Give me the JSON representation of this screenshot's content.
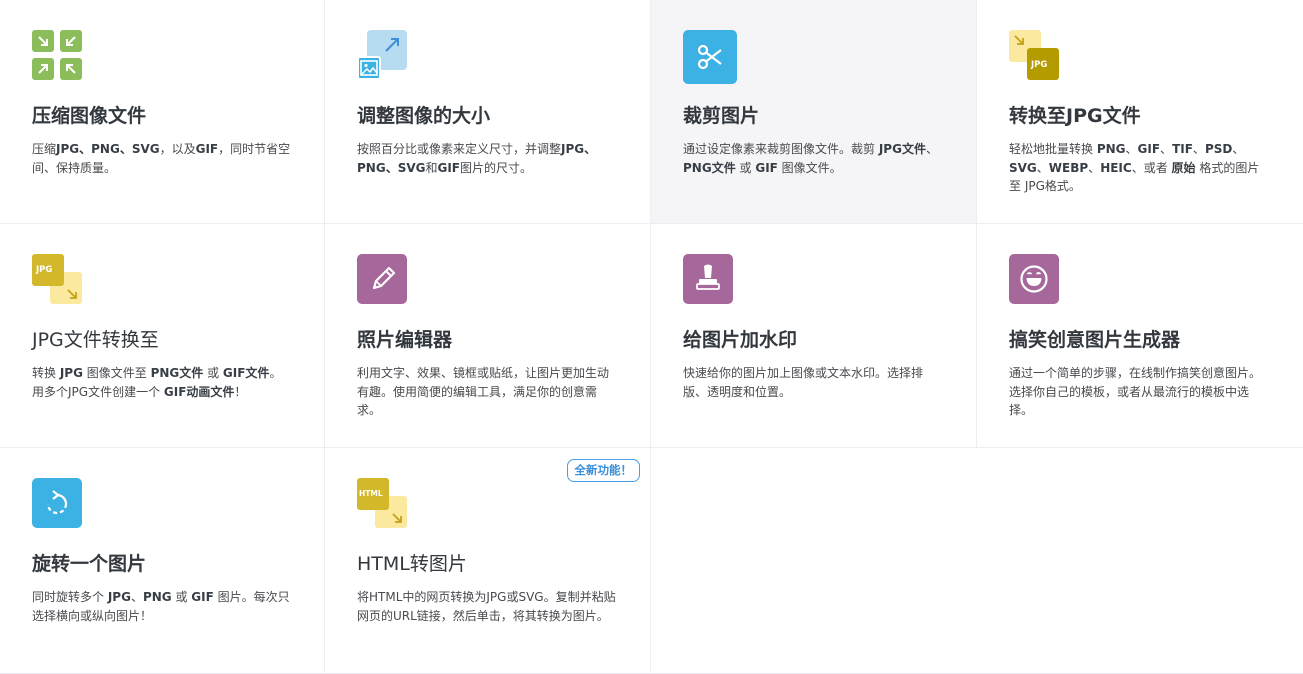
{
  "badge": {
    "new_feature": "全新功能！"
  },
  "tools": [
    {
      "title": "压缩图像文件",
      "desc_parts": [
        "压缩",
        "JPG、PNG、SVG",
        "，以及",
        "GIF",
        "，同时节省空间、保持质量。"
      ]
    },
    {
      "title": "调整图像的大小",
      "desc_parts": [
        "按照百分比或像素来定义尺寸，并调整",
        "JPG、PNG、SVG",
        "和",
        "GIF",
        "图片的尺寸。"
      ]
    },
    {
      "title": "裁剪图片",
      "desc_parts": [
        "通过设定像素来裁剪图像文件。裁剪 ",
        "JPG文件",
        "、",
        "PNG文件",
        " 或 ",
        "GIF",
        " 图像文件。"
      ]
    },
    {
      "title": "转换至JPG文件",
      "icon_label": "JPG",
      "desc_parts": [
        "轻松地批量转换 ",
        "PNG",
        "、",
        "GIF",
        "、",
        "TIF",
        "、",
        "PSD",
        "、",
        "SVG",
        "、",
        "WEBP",
        "、",
        "HEIC",
        "、或者 ",
        "原始",
        " 格式的图片至 JPG格式。"
      ]
    },
    {
      "title": "JPG文件转换至",
      "icon_label": "JPG",
      "desc_parts": [
        "转换 ",
        "JPG",
        " 图像文件至 ",
        "PNG文件",
        " 或 ",
        "GIF文件",
        "。用多个JPG文件创建一个 ",
        "GIF动画文件",
        "！"
      ]
    },
    {
      "title": "照片编辑器",
      "desc_parts": [
        "利用文字、效果、镜框或贴纸，让图片更加生动有趣。使用简便的编辑工具，满足你的创意需求。"
      ]
    },
    {
      "title": "给图片加水印",
      "desc_parts": [
        "快速给你的图片加上图像或文本水印。选择排版、透明度和位置。"
      ]
    },
    {
      "title": "搞笑创意图片生成器",
      "desc_parts": [
        "通过一个简单的步骤，在线制作搞笑创意图片。选择你自己的模板，或者从最流行的模板中选择。"
      ]
    },
    {
      "title": "旋转一个图片",
      "desc_parts": [
        "同时旋转多个 ",
        "JPG",
        "、",
        "PNG",
        " 或 ",
        "GIF",
        " 图片。每次只选择横向或纵向图片！"
      ]
    },
    {
      "title": "HTML转图片",
      "icon_label": "HTML",
      "desc_parts": [
        "将HTML中的网页转换为JPG或SVG。复制并粘贴网页的URL链接，然后单击，将其转换为图片。"
      ]
    }
  ],
  "colors": {
    "green": "#8bbd5b",
    "light_blue": "#b7dcf2",
    "blue": "#3cb1e3",
    "yellow": "#d3b82c",
    "light_yellow": "#fbe9a0",
    "purple": "#a6679a"
  }
}
